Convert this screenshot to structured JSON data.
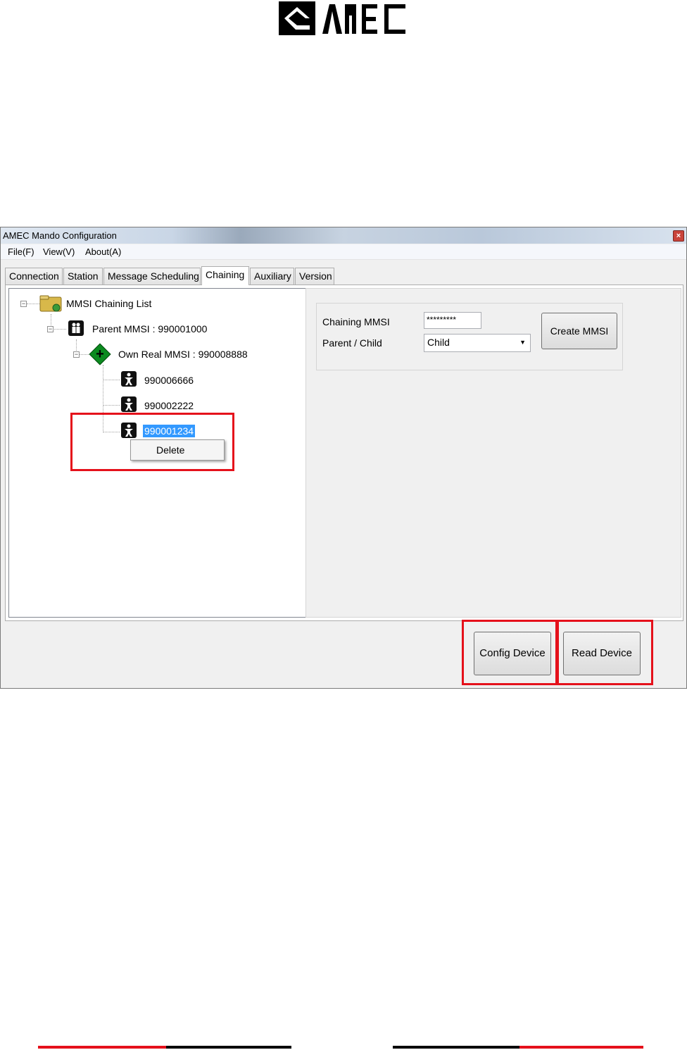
{
  "logo": {
    "text": "AMEC"
  },
  "window": {
    "title": "AMEC Mando Configuration",
    "close_glyph": "×"
  },
  "menu": {
    "items": [
      "File(F)",
      "View(V)",
      "About(A)"
    ]
  },
  "tabs": [
    "Connection",
    "Station",
    "Message Scheduling",
    "Chaining",
    "Auxiliary",
    "Version"
  ],
  "active_tab": "Chaining",
  "tree": {
    "root": "MMSI Chaining List",
    "parent": "Parent MMSI : 990001000",
    "own": "Own Real MMSI : 990008888",
    "children": [
      "990006666",
      "990002222",
      "990001234"
    ],
    "selected": "990001234"
  },
  "context_menu": {
    "item": "Delete"
  },
  "form": {
    "chaining_label": "Chaining MMSI",
    "chaining_value": "*********",
    "parent_child_label": "Parent / Child",
    "parent_child_value": "Child",
    "create_button": "Create MMSI"
  },
  "buttons": {
    "config": "Config Device",
    "read": "Read Device"
  },
  "colors": {
    "highlight": "#e5111b",
    "selection": "#3399ff",
    "footer_red": "#e5111b",
    "footer_black": "#000000"
  },
  "icons": {
    "root": "folder-icon",
    "parent": "group-icon",
    "own": "green-plus-diamond-icon",
    "child": "person-icon",
    "dropdown": "chevron-down-icon"
  }
}
